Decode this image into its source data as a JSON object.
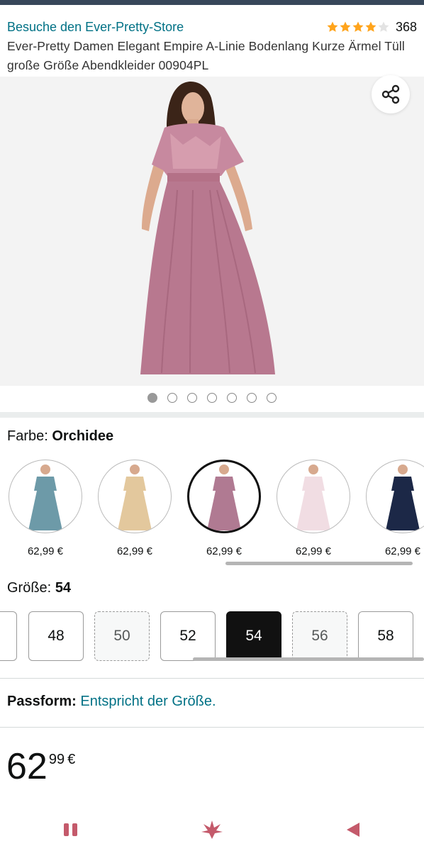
{
  "header": {
    "store_link": "Besuche den Ever-Pretty-Store",
    "rating_count": "368",
    "rating_value": 4.0,
    "title": "Ever-Pretty Damen Elegant Empire A-Linie Bodenlang Kurze Ärmel Tüll große Größe Abendkleider 00904PL"
  },
  "gallery": {
    "image_count": 7,
    "active_index": 0,
    "share_icon": "share-icon"
  },
  "color": {
    "label": "Farbe:",
    "selected": "Orchidee",
    "swatches": [
      {
        "price": "62,99 €",
        "color": "#6d9aa8"
      },
      {
        "price": "62,99 €",
        "color": "#e3c89d"
      },
      {
        "price": "62,99 €",
        "color": "#b07a92"
      },
      {
        "price": "62,99 €",
        "color": "#f1dde3"
      },
      {
        "price": "62,99 €",
        "color": "#1c2847"
      }
    ]
  },
  "size": {
    "label": "Größe:",
    "selected": "54",
    "options": [
      {
        "label": "48",
        "state": "available"
      },
      {
        "label": "50",
        "state": "unavailable"
      },
      {
        "label": "52",
        "state": "available"
      },
      {
        "label": "54",
        "state": "selected"
      },
      {
        "label": "56",
        "state": "unavailable"
      },
      {
        "label": "58",
        "state": "available"
      }
    ]
  },
  "fit": {
    "label": "Passform:",
    "value": "Entspricht der Größe."
  },
  "price": {
    "whole": "62",
    "fraction": "99",
    "currency": "€"
  },
  "navbar": {
    "icons": [
      "recent-apps-icon",
      "home-lotus-icon",
      "back-icon"
    ]
  },
  "colors": {
    "link": "#007185",
    "star": "#ffa41c",
    "selected_size": "#111111"
  }
}
